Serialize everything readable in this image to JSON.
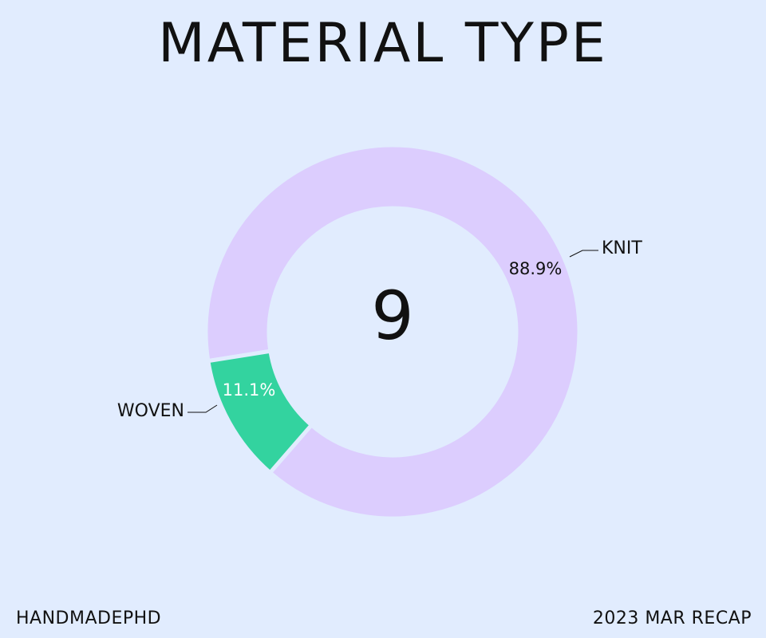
{
  "title": "MATERIAL TYPE",
  "footer": {
    "left": "HANDMADEPHD",
    "right": "2023 MAR RECAP"
  },
  "chart_data": {
    "type": "pie",
    "donut": true,
    "center_label": "9",
    "categories": [
      "KNIT",
      "WOVEN"
    ],
    "values": [
      8,
      1
    ],
    "percent_labels": [
      "88.9%",
      "11.1%"
    ],
    "colors": [
      "#dccdfe",
      "#33d39f"
    ],
    "percent_label_colors": [
      "#111111",
      "#ffffff"
    ],
    "background_color": "#e1ecfe"
  }
}
